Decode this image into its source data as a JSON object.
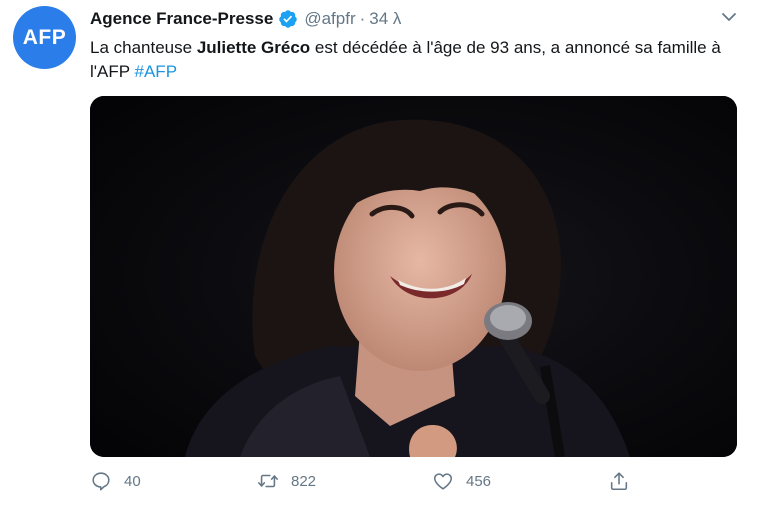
{
  "tweet": {
    "avatar_text": "AFP",
    "author_name": "Agence France-Presse",
    "handle": "@afpfr",
    "separator": "·",
    "time": "34 λ",
    "text": {
      "part1": "La chanteuse ",
      "bold": "Juliette Gréco",
      "part2": " est décédée à l'âge de 93 ans, a annoncé sa famille à l'AFP ",
      "hashtag": "#AFP"
    },
    "media_icon": "photo-singer-at-microphone",
    "actions": {
      "reply_count": "40",
      "retweet_count": "822",
      "like_count": "456"
    }
  },
  "colors": {
    "avatar_bg": "#2b7de9",
    "link": "#1b95e0",
    "muted": "#657786",
    "text": "#14171a"
  }
}
